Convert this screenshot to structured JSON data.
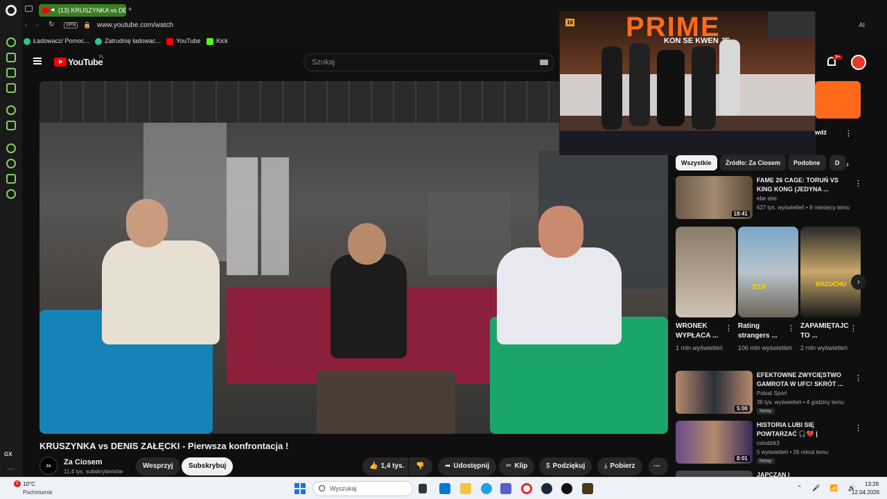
{
  "browser": {
    "tab_title": "(13) KRUSZYNKA vs DE",
    "url": "www.youtube.com/watch",
    "vpn_label": "VPN",
    "new_tab": "+",
    "bookmarks": [
      {
        "label": "Ładowacz/ Pomoc...",
        "color": "#20c997"
      },
      {
        "label": "Zatrudnię ładowac...",
        "color": "#20c997"
      },
      {
        "label": "YouTube",
        "color": "#ff0000"
      },
      {
        "label": "Kick",
        "color": "#53fc18"
      }
    ],
    "gx_label": "GX",
    "top_right_ai": "AI"
  },
  "youtube": {
    "logo_text": "YouTube",
    "region": "PL",
    "search_placeholder": "Szukaj",
    "notification_count": "9+"
  },
  "video": {
    "title": "KRUSZYNKA vs DENIS ZAŁĘCKI - Pierwsza konfrontacja !",
    "channel": "Za Ciosem",
    "channel_avatar_text": "ZA CIOSEM",
    "subscribers": "11,4 tys. subskrybentów",
    "support_label": "Wesprzyj",
    "subscribe_label": "Subskrybuj",
    "likes": "1,4 tys.",
    "share_label": "Udostępnij",
    "clip_label": "Klip",
    "thanks_label": "Podziękuj",
    "download_label": "Pobierz",
    "more": "⋯"
  },
  "chips": [
    "Wszystkie",
    "Źródło: Za Ciosem",
    "Podobne",
    "D"
  ],
  "recommendations": [
    {
      "title": "FAME 26 CAGE: TORUŃ VS KING KONG (JEDYNA ...",
      "channel": "ebe ebe",
      "meta": "627 tys. wyświetleń • 9 miesięcy temu",
      "duration": "18:41",
      "new": ""
    },
    {
      "title": "EFEKTOWNE ZWYCIĘSTWO GAMROTA W UFC! SKRÓT ...",
      "channel": "Polsat Sport",
      "meta": "36 tys. wyświetleń • 4 godziny temu",
      "duration": "5:00",
      "new": "Nowy"
    },
    {
      "title": "HISTORIA LUBI SIĘ POWTARZAĆ 🎧💔 | KŁÓTNIE...",
      "channel": "cslodzik3",
      "meta": "5 wyświetleń • 26 minut temu",
      "duration": "8:01",
      "new": "Nowy"
    },
    {
      "title": "JAPCZAN | MIĘDZYNARODOWA",
      "channel": "",
      "meta": "",
      "duration": "",
      "new": ""
    }
  ],
  "shorts": [
    {
      "title": "WRONEK WYPŁACA ...",
      "views": "1 mln wyświetleń",
      "overlay": ""
    },
    {
      "title": "Rating strangers ...",
      "views": "106 mln wyświetleń",
      "overlay": "7/10"
    },
    {
      "title": "ZAPAMIĘTAJCIE TO ...",
      "views": "2 mln wyświetleń",
      "overlay": "BRZUCHU"
    }
  ],
  "pip": {
    "banner": "PRIME",
    "subbanner": "KON SE KWEN JE",
    "age": "16",
    "caption_partial": "wdź"
  },
  "taskbar": {
    "weather_badge": "2",
    "temperature": "10°C",
    "weather": "Pochmurnie",
    "search": "Wyszukaj",
    "time": "13:28",
    "date": "12.04.2026"
  },
  "colors": {
    "accent_green": "#7fd35c",
    "youtube_red": "#ff0000",
    "background": "#0f0f0f"
  }
}
